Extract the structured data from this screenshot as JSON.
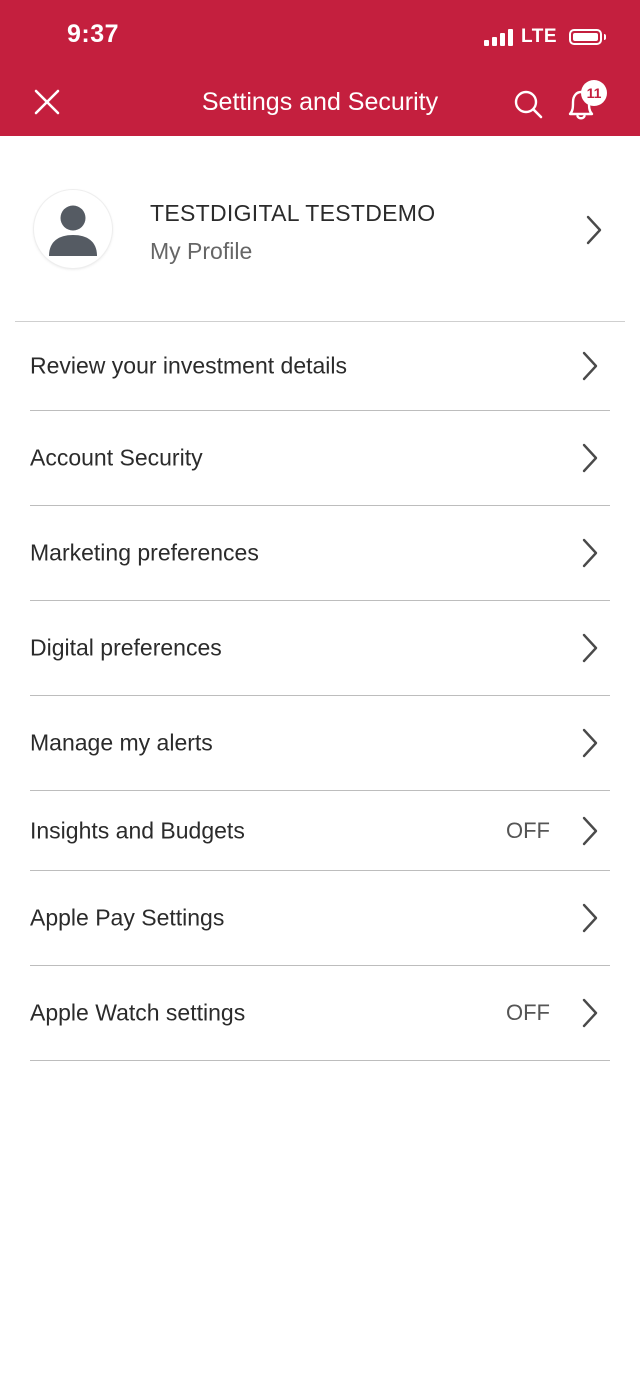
{
  "status_bar": {
    "time": "9:37",
    "network": "LTE"
  },
  "header": {
    "title": "Settings and Security",
    "notification_count": "11",
    "icons": {
      "close": "close-icon",
      "search": "search-icon",
      "notifications": "bell-icon"
    }
  },
  "profile": {
    "name": "TESTDIGITAL TESTDEMO",
    "subtitle": "My Profile"
  },
  "menu": {
    "items": [
      {
        "label": "Review your investment details",
        "status": ""
      },
      {
        "label": "Account Security",
        "status": ""
      },
      {
        "label": "Marketing preferences",
        "status": ""
      },
      {
        "label": "Digital preferences",
        "status": ""
      },
      {
        "label": "Manage my alerts",
        "status": ""
      },
      {
        "label": "Insights and Budgets",
        "status": "OFF"
      },
      {
        "label": "Apple Pay Settings",
        "status": ""
      },
      {
        "label": "Apple Watch settings",
        "status": "OFF"
      }
    ]
  },
  "colors": {
    "brand": "#c41f3e",
    "text": "#2b2b2b",
    "divider": "#bdbdbd"
  }
}
